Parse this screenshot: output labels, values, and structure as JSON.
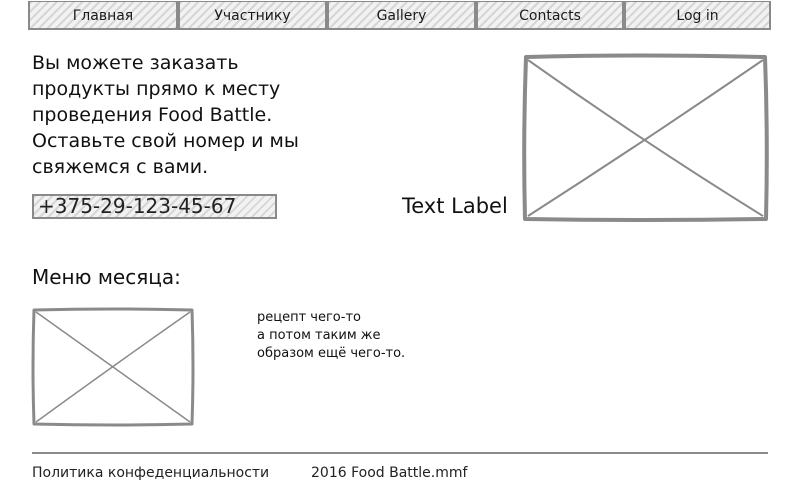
{
  "nav": {
    "tabs": [
      "Главная",
      "Участнику",
      "Gallery",
      "Contacts",
      "Log in"
    ]
  },
  "hero": {
    "lines": [
      "Вы можете заказать",
      "продукты прямо к месту",
      "проведения Food Battle.",
      "Оставьте свой номер и мы",
      "свяжемся с вами."
    ],
    "phone": "+375-29-123-45-67",
    "image_label": "Text Label"
  },
  "menu": {
    "title": "Меню месяца:",
    "recipe_lines": [
      "рецепт чего-то",
      "а потом таким же",
      "образом ещё чего-то."
    ]
  },
  "footer": {
    "privacy": "Политика конфеденциальности",
    "copyright": "2016 Food Battle.mmf"
  },
  "colors": {
    "stroke": "#8a8a8a",
    "hatch": "#d6d6d6"
  },
  "icons": {
    "placeholder": "image-placeholder-icon"
  }
}
